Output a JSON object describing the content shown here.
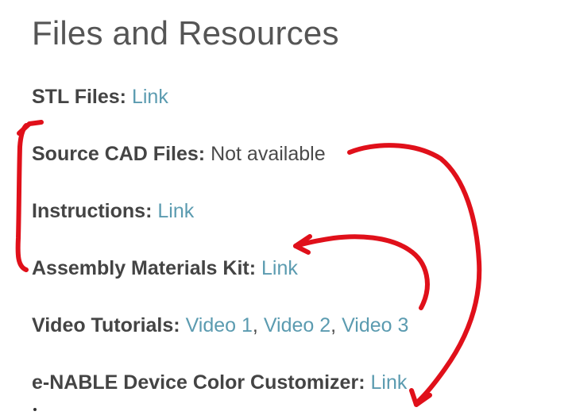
{
  "page": {
    "title": "Files and Resources"
  },
  "resources": [
    {
      "label": "STL Files:",
      "value": "Link",
      "value_is_link": true
    },
    {
      "label": "Source CAD Files:",
      "value": "Not available",
      "value_is_link": false
    },
    {
      "label": "Instructions:",
      "value": "Link",
      "value_is_link": true
    },
    {
      "label": "Assembly Materials Kit:",
      "value": "Link",
      "value_is_link": true
    },
    {
      "label": "Video Tutorials:",
      "links": [
        "Video 1",
        "Video 2",
        "Video 3"
      ],
      "separator": ", "
    },
    {
      "label": "e-NABLE Device Color Customizer:",
      "value": "Link",
      "value_is_link": true
    }
  ],
  "annotation_color": "#e0101a",
  "link_color": "#5b9bb0"
}
